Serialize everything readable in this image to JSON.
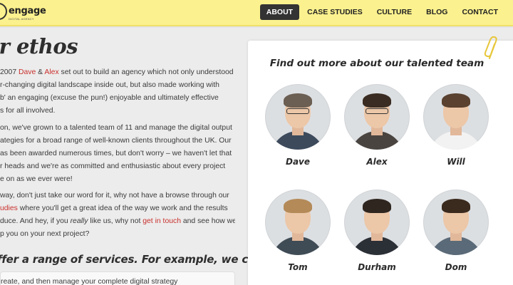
{
  "header": {
    "logo_text": "engage",
    "logo_tagline": "DIGITAL AGENCY",
    "nav": [
      {
        "label": "ABOUT",
        "active": true
      },
      {
        "label": "CASE STUDIES",
        "active": false
      },
      {
        "label": "CULTURE",
        "active": false
      },
      {
        "label": "BLOG",
        "active": false
      },
      {
        "label": "CONTACT",
        "active": false
      }
    ],
    "bg_color": "#fbf18e"
  },
  "main": {
    "title": "ur ethos",
    "p1": {
      "l1_a": " 2007 ",
      "l1_dave": "Dave",
      "l1_amp": " & ",
      "l1_alex": "Alex",
      "l1_b": " set out to build an agency which not only understood",
      "l2": "r-changing digital landscape inside out, but also made working with",
      "l3": "b' an engaging (excuse the pun!) enjoyable and ultimately effective",
      "l4": "s for all involved."
    },
    "p2": {
      "l1": "on, we've grown to a talented team of 11 and manage the digital output",
      "l2": "ategies for a broad range of well-known clients throughout the UK. Our",
      "l3": "as been awarded numerous times, but don't worry – we haven't let that",
      "l4": "r heads and we're as committed and enthusiastic about every project",
      "l5": "e on as we ever were!"
    },
    "p3": {
      "l1": "way, don't just take our word for it, why not have a browse through our",
      "l2_link": "udies",
      "l2_rest": " where you'll get a great idea of the way we work and the results",
      "l3": "duce. And hey, if you ",
      "l3_it": "really",
      "l3_b": " like us, why not ",
      "l3_link": "get in touch",
      "l3_c": " and see how we",
      "l4": "p you on your next project?"
    },
    "services_heading": "ffer a range of services. For example, we could:",
    "services_first": "reate, and then manage your complete digital strategy"
  },
  "team_panel": {
    "title": "Find out more about our talented team",
    "members": [
      {
        "name": "Dave",
        "hair": "#6b5e52",
        "shirt": "#3d4a5c",
        "glasses": true
      },
      {
        "name": "Alex",
        "hair": "#3a2c22",
        "shirt": "#4a4440",
        "glasses": true
      },
      {
        "name": "Will",
        "hair": "#5a4130",
        "shirt": "#f2f2f2",
        "glasses": false
      },
      {
        "name": "Tom",
        "hair": "#b48a58",
        "shirt": "#3f4b55",
        "glasses": false
      },
      {
        "name": "Durham",
        "hair": "#2f2620",
        "shirt": "#2b2f36",
        "glasses": false
      },
      {
        "name": "Dom",
        "hair": "#3b2a1e",
        "shirt": "#5b6a78",
        "glasses": false
      }
    ]
  },
  "colors": {
    "link": "#c8302c",
    "nav_active_bg": "#333333",
    "page_bg": "#ececec"
  }
}
